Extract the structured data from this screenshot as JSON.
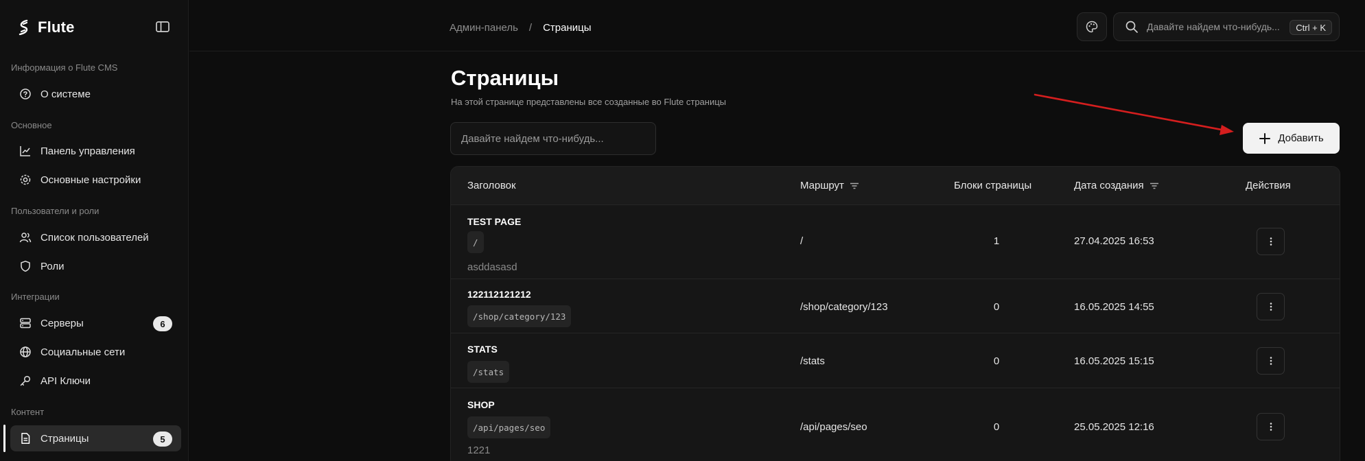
{
  "app": {
    "name": "Flute"
  },
  "sidebar": {
    "sections": [
      {
        "label": "Информация о Flute CMS"
      },
      {
        "label": "Основное"
      },
      {
        "label": "Пользователи и роли"
      },
      {
        "label": "Интеграции"
      },
      {
        "label": "Контент"
      }
    ],
    "items": [
      {
        "label": "О системе",
        "icon": "help-circle-icon"
      },
      {
        "label": "Панель управления",
        "icon": "chart-line-icon"
      },
      {
        "label": "Основные настройки",
        "icon": "gear-icon"
      },
      {
        "label": "Список пользователей",
        "icon": "users-icon"
      },
      {
        "label": "Роли",
        "icon": "shield-icon"
      },
      {
        "label": "Серверы",
        "icon": "server-icon",
        "badge": "6"
      },
      {
        "label": "Социальные сети",
        "icon": "globe-icon"
      },
      {
        "label": "API Ключи",
        "icon": "key-icon"
      },
      {
        "label": "Страницы",
        "icon": "file-icon",
        "badge": "5",
        "active": true
      }
    ]
  },
  "topbar": {
    "breadcrumb": {
      "parent": "Админ-панель",
      "separator": "/",
      "current": "Страницы"
    },
    "search_placeholder": "Давайте найдем что-нибудь...",
    "shortcut": "Ctrl + K"
  },
  "page": {
    "title": "Страницы",
    "subtitle": "На этой странице представлены все созданные во Flute страницы",
    "search_placeholder": "Давайте найдем что-нибудь...",
    "add_label": "Добавить"
  },
  "table": {
    "columns": {
      "title": "Заголовок",
      "route": "Маршрут",
      "blocks": "Блоки страницы",
      "created": "Дата создания",
      "actions": "Действия"
    },
    "rows": [
      {
        "title": "TEST PAGE",
        "slug": "/",
        "description": "asddasasd",
        "route": "/",
        "blocks": "1",
        "created": "27.04.2025 16:53"
      },
      {
        "title": "122112121212",
        "slug": "/shop/category/123",
        "description": "",
        "route": "/shop/category/123",
        "blocks": "0",
        "created": "16.05.2025 14:55"
      },
      {
        "title": "STATS",
        "slug": "/stats",
        "description": "",
        "route": "/stats",
        "blocks": "0",
        "created": "16.05.2025 15:15"
      },
      {
        "title": "SHOP",
        "slug": "/api/pages/seo",
        "description": "1221",
        "route": "/api/pages/seo",
        "blocks": "0",
        "created": "25.05.2025 12:16"
      }
    ]
  },
  "colors": {
    "background": "#0d0d0d",
    "sidebar": "#111111",
    "accent_button": "#f2f2f2",
    "annotation_arrow": "#d41e1e"
  }
}
